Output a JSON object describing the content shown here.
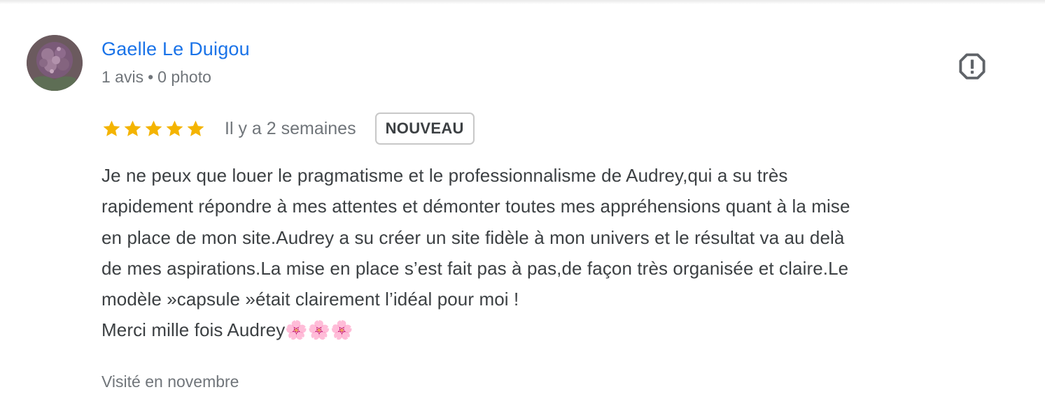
{
  "review": {
    "author": {
      "name": "Gaelle Le Duigou",
      "reviews_count": "1 avis",
      "separator": "•",
      "photos_count": "0 photo",
      "avatar_icon": "hydrangea-photo"
    },
    "rating": {
      "stars": 5,
      "max_stars": 5,
      "star_color": "#f4b400"
    },
    "date": "Il y a 2 semaines",
    "badge": "NOUVEAU",
    "text": "Je ne peux que louer le pragmatisme et le professionnalisme de Audrey,qui a su très\nrapidement répondre à mes attentes et démonter toutes mes appréhensions quant à la mise\nen place de mon site.Audrey a su créer un site fidèle à mon univers et le résultat va au delà\nde mes aspirations.La mise en place s’est fait pas à pas,de façon très organisée et claire.Le\nmodèle »capsule »était clairement l’idéal pour moi !\nMerci mille fois Audrey🌸🌸🌸",
    "visited": "Visité en novembre",
    "report_icon": "report-octagon-icon"
  },
  "colors": {
    "link": "#1a73e8",
    "secondary_text": "#70757a",
    "body_text": "#3c4043"
  }
}
